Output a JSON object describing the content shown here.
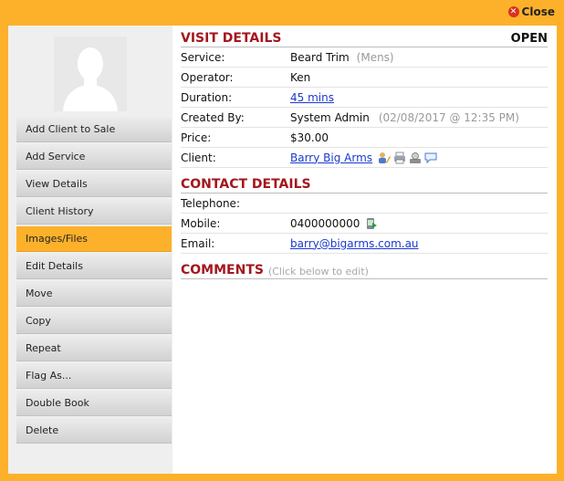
{
  "close": {
    "label": "Close"
  },
  "sidebar": {
    "items": [
      {
        "label": "Add Client to Sale"
      },
      {
        "label": "Add Service"
      },
      {
        "label": "View Details"
      },
      {
        "label": "Client History"
      },
      {
        "label": "Images/Files",
        "active": true
      },
      {
        "label": "Edit Details"
      },
      {
        "label": "Move"
      },
      {
        "label": "Copy"
      },
      {
        "label": "Repeat"
      },
      {
        "label": "Flag As..."
      },
      {
        "label": "Double Book"
      },
      {
        "label": "Delete"
      }
    ]
  },
  "visit": {
    "title": "VISIT DETAILS",
    "status": "OPEN",
    "service_label": "Service:",
    "service_value": "Beard Trim",
    "service_category": "(Mens)",
    "operator_label": "Operator:",
    "operator_value": "Ken",
    "duration_label": "Duration:",
    "duration_value": "45 mins",
    "created_label": "Created By:",
    "created_value": "System Admin",
    "created_date": "(02/08/2017 @ 12:35 PM)",
    "price_label": "Price:",
    "price_value": "$30.00",
    "client_label": "Client:",
    "client_value": "Barry Big Arms"
  },
  "contact": {
    "title": "CONTACT DETAILS",
    "telephone_label": "Telephone:",
    "telephone_value": "",
    "mobile_label": "Mobile:",
    "mobile_value": "0400000000",
    "email_label": "Email:",
    "email_value": "barry@bigarms.com.au"
  },
  "comments": {
    "title": "COMMENTS",
    "hint": "(Click below to edit)"
  },
  "colors": {
    "background": "#FDB12A",
    "section_title": "#A3171E",
    "link": "#1A3ACF",
    "active_menu": "#FDB12A"
  }
}
